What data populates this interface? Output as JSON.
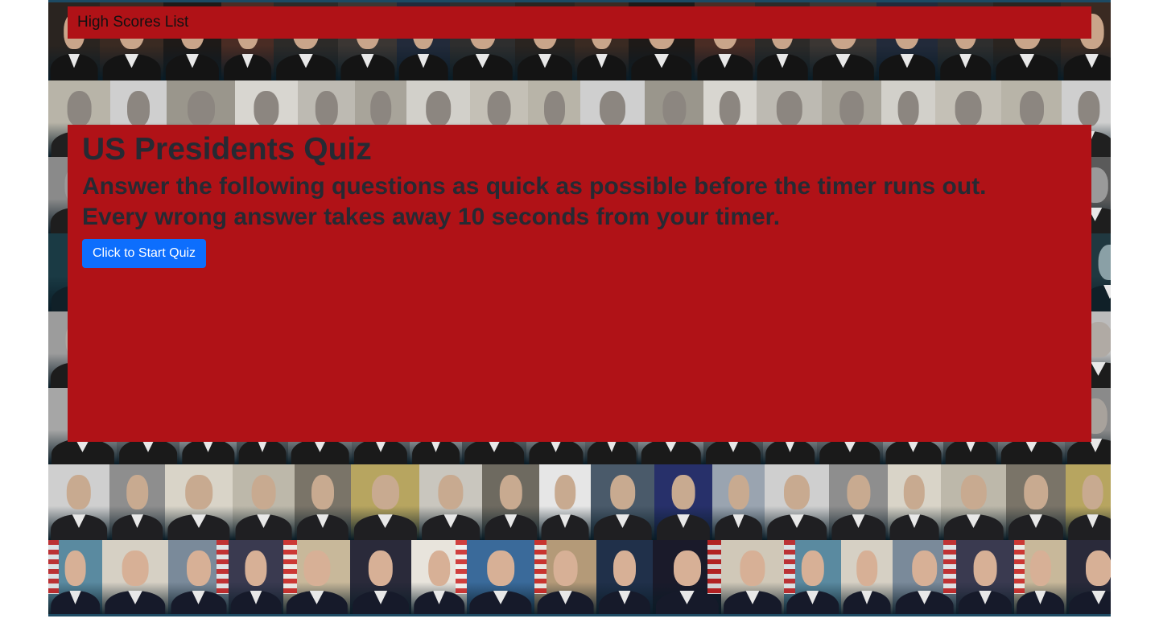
{
  "nav": {
    "high_scores_link": "High Scores List"
  },
  "quiz": {
    "title": "US Presidents Quiz",
    "instructions": "Answer the following questions as quick as possible before the timer runs out. Every wrong answer takes away 10 seconds from your timer.",
    "start_button": "Click to Start Quiz"
  },
  "colors": {
    "panel_red": "#b01217",
    "title_text": "#262a33",
    "button_blue": "#0d6efd",
    "background_frame": "#0d2a3a"
  }
}
